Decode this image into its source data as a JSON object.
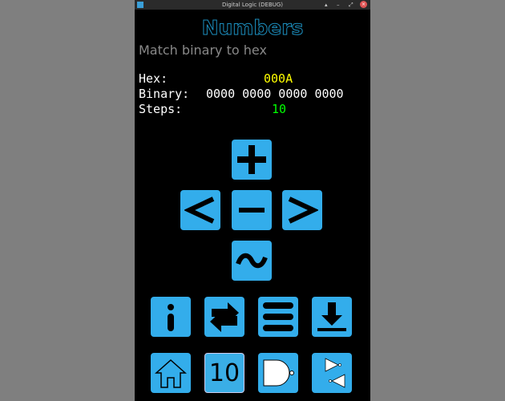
{
  "window": {
    "title": "Digital Logic (DEBUG)"
  },
  "header": {
    "title": "Numbers",
    "subtitle": "Match binary to hex"
  },
  "info": {
    "hex_label": "Hex:",
    "hex_value": "000A",
    "binary_label": "Binary:",
    "binary_value": "0000 0000 0000 0000",
    "steps_label": "Steps:",
    "steps_value": "10"
  },
  "colors": {
    "accent": "#33adeb",
    "hex": "#ffff00",
    "steps": "#00ff00"
  },
  "toolbar": {
    "base_label": "10"
  }
}
